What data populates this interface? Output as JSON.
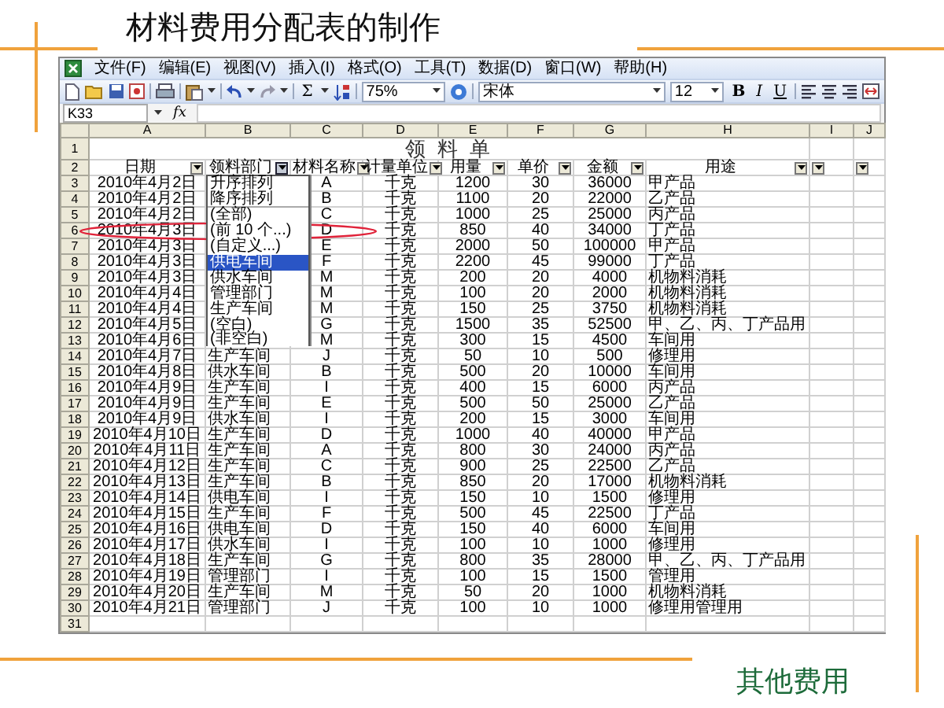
{
  "slide": {
    "title": "材料费用分配表的制作",
    "footer": "其他费用"
  },
  "window": {
    "menu": [
      "文件(F)",
      "编辑(E)",
      "视图(V)",
      "插入(I)",
      "格式(O)",
      "工具(T)",
      "数据(D)",
      "窗口(W)",
      "帮助(H)"
    ],
    "toolbar": {
      "sum": "Σ",
      "zoom": "75%",
      "font": "宋体",
      "font_size": "12",
      "bold": "B",
      "italic": "I",
      "underline": "U"
    },
    "name_box": "K33",
    "fx": "fx"
  },
  "sheet": {
    "columns": [
      "A",
      "B",
      "C",
      "D",
      "E",
      "F",
      "G",
      "H",
      "I",
      "J"
    ],
    "title": "领 料 单",
    "headers": [
      {
        "label": "日期",
        "open": false
      },
      {
        "label": "领料部门",
        "open": true
      },
      {
        "label": "材料名称",
        "open": false
      },
      {
        "label": "计量单位",
        "open": false
      },
      {
        "label": "用量",
        "open": false
      },
      {
        "label": "单价",
        "open": false
      },
      {
        "label": "金额",
        "open": false
      },
      {
        "label": "用途",
        "open": false
      },
      {
        "open": false
      },
      {
        "open": false
      }
    ],
    "rows": [
      {
        "n": "3",
        "date": "2010年4月2日",
        "material": "A",
        "unit": "千克",
        "qty": "1200",
        "price": "30",
        "amount": "36000",
        "use": "甲产品",
        "circled": false
      },
      {
        "n": "4",
        "date": "2010年4月2日",
        "material": "B",
        "unit": "千克",
        "qty": "1100",
        "price": "20",
        "amount": "22000",
        "use": "乙产品",
        "circled": false
      },
      {
        "n": "5",
        "date": "2010年4月2日",
        "material": "C",
        "unit": "千克",
        "qty": "1000",
        "price": "25",
        "amount": "25000",
        "use": "丙产品",
        "circled": false
      },
      {
        "n": "6",
        "date": "2010年4月3日",
        "material": "D",
        "unit": "千克",
        "qty": "850",
        "price": "40",
        "amount": "34000",
        "use": "丁产品",
        "circled": true
      },
      {
        "n": "7",
        "date": "2010年4月3日",
        "material": "E",
        "unit": "千克",
        "qty": "2000",
        "price": "50",
        "amount": "100000",
        "use": "甲产品",
        "circled": false
      },
      {
        "n": "8",
        "date": "2010年4月3日",
        "material": "F",
        "unit": "千克",
        "qty": "2200",
        "price": "45",
        "amount": "99000",
        "use": "丁产品",
        "circled": false
      },
      {
        "n": "9",
        "date": "2010年4月3日",
        "material": "M",
        "unit": "千克",
        "qty": "200",
        "price": "20",
        "amount": "4000",
        "use": "机物料消耗",
        "circled": false
      },
      {
        "n": "10",
        "date": "2010年4月4日",
        "material": "M",
        "unit": "千克",
        "qty": "100",
        "price": "20",
        "amount": "2000",
        "use": "机物料消耗",
        "circled": false
      },
      {
        "n": "11",
        "date": "2010年4月4日",
        "material": "M",
        "unit": "千克",
        "qty": "150",
        "price": "25",
        "amount": "3750",
        "use": "机物料消耗",
        "circled": false
      },
      {
        "n": "12",
        "date": "2010年4月5日",
        "material": "G",
        "unit": "千克",
        "qty": "1500",
        "price": "35",
        "amount": "52500",
        "use": "甲、乙、丙、丁产品用",
        "circled": false
      },
      {
        "n": "13",
        "date": "2010年4月6日",
        "material": "M",
        "unit": "千克",
        "qty": "300",
        "price": "15",
        "amount": "4500",
        "use": "车间用",
        "circled": false
      },
      {
        "n": "14",
        "date": "2010年4月7日",
        "dept": "生产车间",
        "material": "J",
        "unit": "千克",
        "qty": "50",
        "price": "10",
        "amount": "500",
        "use": "修理用",
        "circled": false
      },
      {
        "n": "15",
        "date": "2010年4月8日",
        "dept": "供水车间",
        "material": "B",
        "unit": "千克",
        "qty": "500",
        "price": "20",
        "amount": "10000",
        "use": "车间用",
        "circled": false
      },
      {
        "n": "16",
        "date": "2010年4月9日",
        "dept": "生产车间",
        "material": "I",
        "unit": "千克",
        "qty": "400",
        "price": "15",
        "amount": "6000",
        "use": "丙产品",
        "circled": false
      },
      {
        "n": "17",
        "date": "2010年4月9日",
        "dept": "生产车间",
        "material": "E",
        "unit": "千克",
        "qty": "500",
        "price": "50",
        "amount": "25000",
        "use": "乙产品",
        "circled": false
      },
      {
        "n": "18",
        "date": "2010年4月9日",
        "dept": "供水车间",
        "material": "I",
        "unit": "千克",
        "qty": "200",
        "price": "15",
        "amount": "3000",
        "use": "车间用",
        "circled": false
      },
      {
        "n": "19",
        "date": "2010年4月10日",
        "dept": "生产车间",
        "material": "D",
        "unit": "千克",
        "qty": "1000",
        "price": "40",
        "amount": "40000",
        "use": "甲产品",
        "circled": false
      },
      {
        "n": "20",
        "date": "2010年4月11日",
        "dept": "生产车间",
        "material": "A",
        "unit": "千克",
        "qty": "800",
        "price": "30",
        "amount": "24000",
        "use": "丙产品",
        "circled": false
      },
      {
        "n": "21",
        "date": "2010年4月12日",
        "dept": "生产车间",
        "material": "C",
        "unit": "千克",
        "qty": "900",
        "price": "25",
        "amount": "22500",
        "use": "乙产品",
        "circled": false
      },
      {
        "n": "22",
        "date": "2010年4月13日",
        "dept": "生产车间",
        "material": "B",
        "unit": "千克",
        "qty": "850",
        "price": "20",
        "amount": "17000",
        "use": "机物料消耗",
        "circled": false
      },
      {
        "n": "23",
        "date": "2010年4月14日",
        "dept": "供电车间",
        "material": "I",
        "unit": "千克",
        "qty": "150",
        "price": "10",
        "amount": "1500",
        "use": "修理用",
        "circled": false
      },
      {
        "n": "24",
        "date": "2010年4月15日",
        "dept": "生产车间",
        "material": "F",
        "unit": "千克",
        "qty": "500",
        "price": "45",
        "amount": "22500",
        "use": "丁产品",
        "circled": false
      },
      {
        "n": "25",
        "date": "2010年4月16日",
        "dept": "供电车间",
        "material": "D",
        "unit": "千克",
        "qty": "150",
        "price": "40",
        "amount": "6000",
        "use": "车间用",
        "circled": false
      },
      {
        "n": "26",
        "date": "2010年4月17日",
        "dept": "供水车间",
        "material": "I",
        "unit": "千克",
        "qty": "100",
        "price": "10",
        "amount": "1000",
        "use": "修理用",
        "circled": false
      },
      {
        "n": "27",
        "date": "2010年4月18日",
        "dept": "生产车间",
        "material": "G",
        "unit": "千克",
        "qty": "800",
        "price": "35",
        "amount": "28000",
        "use": "甲、乙、丙、丁产品用",
        "circled": false
      },
      {
        "n": "28",
        "date": "2010年4月19日",
        "dept": "管理部门",
        "material": "I",
        "unit": "千克",
        "qty": "100",
        "price": "15",
        "amount": "1500",
        "use": "管理用",
        "circled": false
      },
      {
        "n": "29",
        "date": "2010年4月20日",
        "dept": "生产车间",
        "material": "M",
        "unit": "千克",
        "qty": "50",
        "price": "20",
        "amount": "1000",
        "use": "机物料消耗",
        "circled": false
      },
      {
        "n": "30",
        "date": "2010年4月21日",
        "dept": "管理部门",
        "material": "J",
        "unit": "千克",
        "qty": "100",
        "price": "10",
        "amount": "1000",
        "use": "修理用管理用",
        "circled": false
      }
    ],
    "title_row": "1",
    "header_row": "2",
    "empty_rows": [
      "31"
    ]
  },
  "filter_menu": {
    "items": [
      {
        "label": "升序排列",
        "selected": false
      },
      {
        "label": "降序排列",
        "selected": false
      },
      {
        "label": "(全部)",
        "selected": false
      },
      {
        "label": "(前 10 个...)",
        "selected": false
      },
      {
        "label": "(自定义...)",
        "selected": false
      },
      {
        "label": "供电车间",
        "selected": true
      },
      {
        "label": "供水车间",
        "selected": false
      },
      {
        "label": "管理部门",
        "selected": false
      },
      {
        "label": "生产车间",
        "selected": false
      },
      {
        "label": "(空白)",
        "selected": false
      },
      {
        "label": "(非空白)",
        "selected": false
      }
    ]
  }
}
